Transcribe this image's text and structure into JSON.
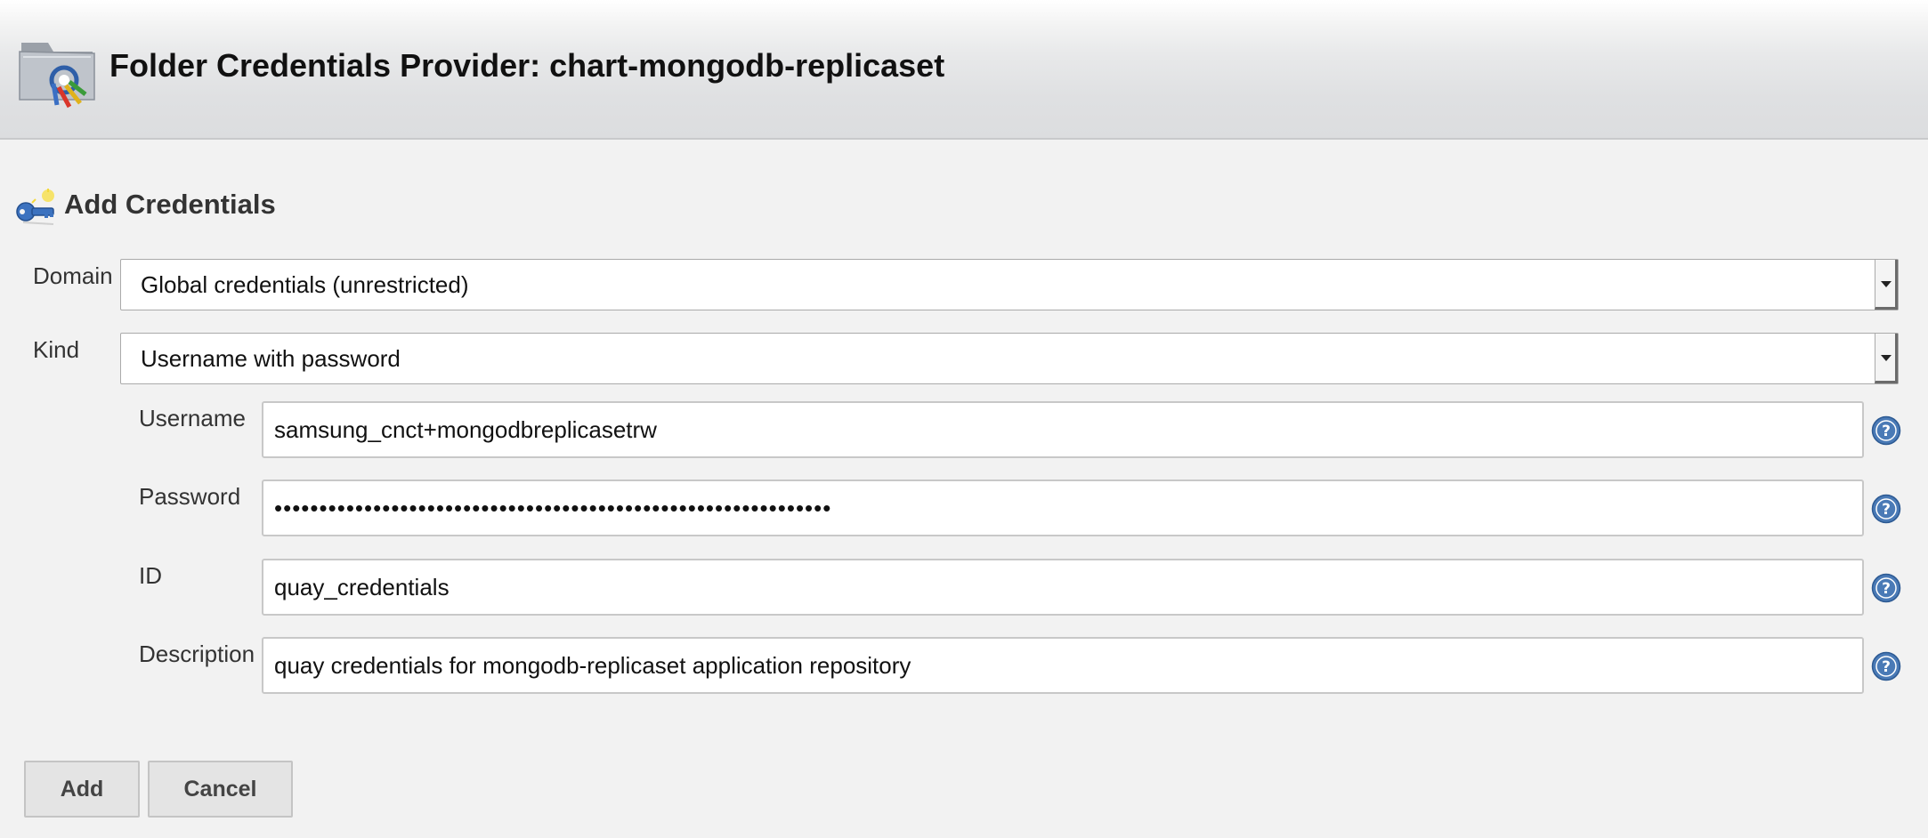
{
  "header": {
    "title": "Folder Credentials Provider: chart-mongodb-replicaset",
    "icon": "folder-credentials-icon"
  },
  "section": {
    "title": "Add Credentials",
    "icon": "key-icon"
  },
  "form": {
    "domain": {
      "label": "Domain",
      "value": "Global credentials (unrestricted)"
    },
    "kind": {
      "label": "Kind",
      "value": "Username with password"
    },
    "username": {
      "label": "Username",
      "value": "samsung_cnct+mongodbreplicasetrw"
    },
    "password": {
      "label": "Password",
      "value": "••••••••••••••••••••••••••••••••••••••••••••••••••••••••••••••"
    },
    "id": {
      "label": "ID",
      "value": "quay_credentials"
    },
    "description": {
      "label": "Description",
      "value": "quay credentials for mongodb-replicaset application repository"
    }
  },
  "buttons": {
    "add": "Add",
    "cancel": "Cancel"
  },
  "colors": {
    "help_icon_blue": "#4a7ab6",
    "background": "#f2f2f2"
  }
}
